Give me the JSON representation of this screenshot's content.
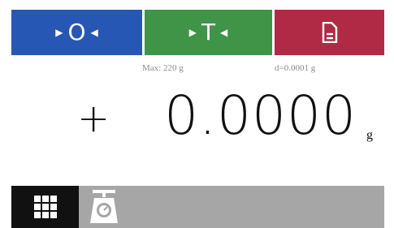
{
  "toolbar": {
    "zero_label": "O",
    "tare_label": "T",
    "zero_icon": "zero-icon",
    "tare_icon": "tare-icon",
    "print_icon": "document-icon",
    "colors": {
      "zero": "#2757b4",
      "tare": "#3f9447",
      "print": "#b02a45"
    }
  },
  "info": {
    "max": "Max: 220 g",
    "readability": "d=0.0001 g"
  },
  "display": {
    "sign": "+",
    "value": "0.0000",
    "unit": "g"
  },
  "bottombar": {
    "menu_icon": "grid-menu-icon",
    "mode_icon": "weighing-scale-icon",
    "background": "#a6a6a6"
  }
}
